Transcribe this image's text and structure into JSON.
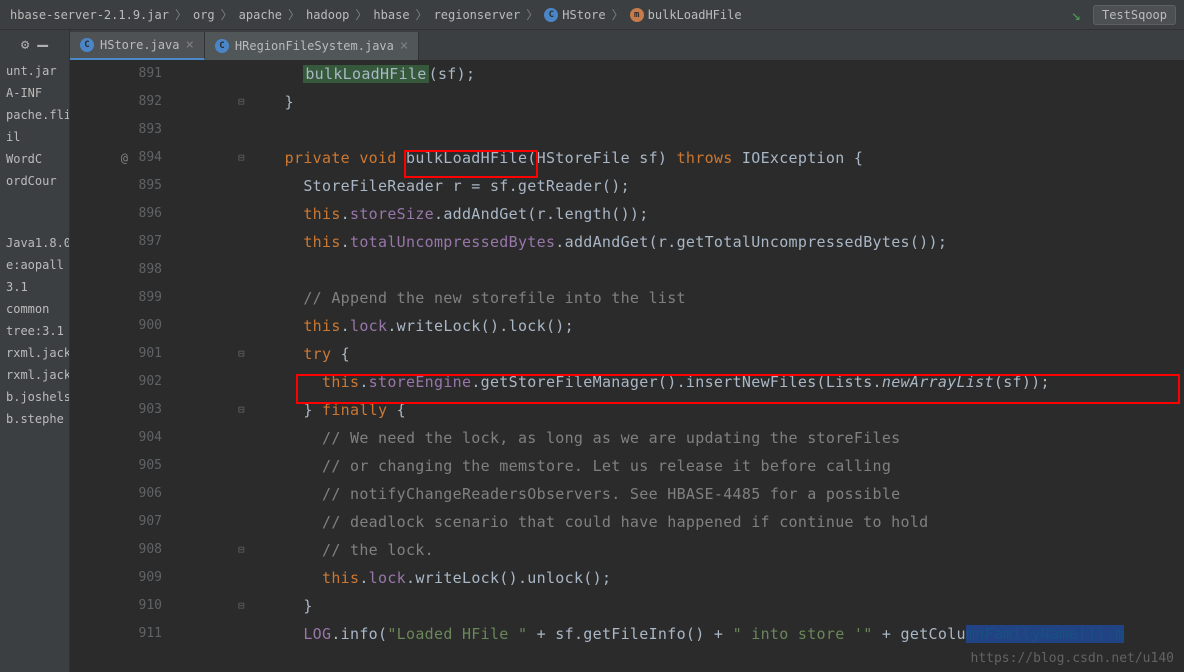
{
  "breadcrumb": {
    "jar": "hbase-server-2.1.9.jar",
    "parts": [
      "org",
      "apache",
      "hadoop",
      "hbase",
      "regionserver"
    ],
    "class": "HStore",
    "method": "bulkLoadHFile"
  },
  "config_name": "TestSqoop",
  "tabs": [
    {
      "label": "HStore.java",
      "active": true
    },
    {
      "label": "HRegionFileSystem.java",
      "active": false
    }
  ],
  "sidebar": {
    "items": [
      "unt.jar",
      "A-INF",
      "pache.fli",
      "il",
      "WordC",
      "ordCour",
      "",
      "",
      "",
      "",
      "",
      "Java1.8.0",
      "e:aopall",
      "3.1",
      "common",
      "tree:3.1",
      "rxml.jack",
      "rxml.jack",
      "b.joshels",
      "b.stephe"
    ]
  },
  "lines": [
    {
      "num": "891",
      "indent": 2,
      "tokens": [
        {
          "t": "method-highlight",
          "v": "bulkLoadHFile"
        },
        {
          "t": "",
          "v": "(sf);"
        }
      ]
    },
    {
      "num": "892",
      "indent": 1,
      "fold": true,
      "tokens": [
        {
          "t": "",
          "v": "}"
        }
      ]
    },
    {
      "num": "893",
      "indent": 0,
      "tokens": []
    },
    {
      "num": "894",
      "anno": "@",
      "fold": true,
      "indent": 1,
      "tokens": [
        {
          "t": "kw",
          "v": "private void "
        },
        {
          "t": "",
          "v": "bulkLoadHFile(HStoreFile sf) "
        },
        {
          "t": "kw",
          "v": "throws "
        },
        {
          "t": "",
          "v": "IOException {"
        }
      ]
    },
    {
      "num": "895",
      "indent": 2,
      "tokens": [
        {
          "t": "",
          "v": "StoreFileReader r = sf.getReader();"
        }
      ]
    },
    {
      "num": "896",
      "indent": 2,
      "tokens": [
        {
          "t": "kw",
          "v": "this"
        },
        {
          "t": "",
          "v": "."
        },
        {
          "t": "field",
          "v": "storeSize"
        },
        {
          "t": "",
          "v": ".addAndGet(r.length());"
        }
      ]
    },
    {
      "num": "897",
      "indent": 2,
      "tokens": [
        {
          "t": "kw",
          "v": "this"
        },
        {
          "t": "",
          "v": "."
        },
        {
          "t": "field",
          "v": "totalUncompressedBytes"
        },
        {
          "t": "",
          "v": ".addAndGet(r.getTotalUncompressedBytes());"
        }
      ]
    },
    {
      "num": "898",
      "indent": 0,
      "tokens": []
    },
    {
      "num": "899",
      "indent": 2,
      "tokens": [
        {
          "t": "comment",
          "v": "// Append the new storefile into the list"
        }
      ]
    },
    {
      "num": "900",
      "indent": 2,
      "tokens": [
        {
          "t": "kw",
          "v": "this"
        },
        {
          "t": "",
          "v": "."
        },
        {
          "t": "field",
          "v": "lock"
        },
        {
          "t": "",
          "v": ".writeLock().lock();"
        }
      ]
    },
    {
      "num": "901",
      "indent": 2,
      "fold": true,
      "tokens": [
        {
          "t": "kw",
          "v": "try "
        },
        {
          "t": "",
          "v": "{"
        }
      ]
    },
    {
      "num": "902",
      "indent": 3,
      "tokens": [
        {
          "t": "kw",
          "v": "this"
        },
        {
          "t": "",
          "v": "."
        },
        {
          "t": "field",
          "v": "storeEngine"
        },
        {
          "t": "",
          "v": ".getStoreFileManager().insertNewFiles(Lists."
        },
        {
          "t": "italic-static",
          "v": "newArrayList"
        },
        {
          "t": "",
          "v": "(sf));"
        }
      ]
    },
    {
      "num": "903",
      "indent": 2,
      "fold": true,
      "tokens": [
        {
          "t": "",
          "v": "} "
        },
        {
          "t": "kw",
          "v": "finally "
        },
        {
          "t": "",
          "v": "{"
        }
      ]
    },
    {
      "num": "904",
      "indent": 3,
      "tokens": [
        {
          "t": "comment",
          "v": "// We need the lock, as long as we are updating the storeFiles"
        }
      ]
    },
    {
      "num": "905",
      "indent": 3,
      "tokens": [
        {
          "t": "comment",
          "v": "// or changing the memstore. Let us release it before calling"
        }
      ]
    },
    {
      "num": "906",
      "indent": 3,
      "tokens": [
        {
          "t": "comment",
          "v": "// notifyChangeReadersObservers. See HBASE-4485 for a possible"
        }
      ]
    },
    {
      "num": "907",
      "indent": 3,
      "tokens": [
        {
          "t": "comment",
          "v": "// deadlock scenario that could have happened if continue to hold"
        }
      ]
    },
    {
      "num": "908",
      "indent": 3,
      "fold": true,
      "tokens": [
        {
          "t": "comment",
          "v": "// the lock."
        }
      ]
    },
    {
      "num": "909",
      "indent": 3,
      "tokens": [
        {
          "t": "kw",
          "v": "this"
        },
        {
          "t": "",
          "v": "."
        },
        {
          "t": "field",
          "v": "lock"
        },
        {
          "t": "",
          "v": ".writeLock().unlock();"
        }
      ]
    },
    {
      "num": "910",
      "indent": 2,
      "fold": true,
      "tokens": [
        {
          "t": "",
          "v": "}"
        }
      ]
    },
    {
      "num": "911",
      "indent": 2,
      "tokens": [
        {
          "t": "field",
          "v": "LOG"
        },
        {
          "t": "",
          "v": ".info("
        },
        {
          "t": "str",
          "v": "\"Loaded HFile \""
        },
        {
          "t": "",
          "v": " + sf.getFileInfo() + "
        },
        {
          "t": "str",
          "v": "\" into store '\""
        },
        {
          "t": "",
          "v": " + getColu"
        },
        {
          "t": "selected-blue",
          "v": "mnFamilyName()).m"
        }
      ]
    }
  ],
  "watermark": "https://blog.csdn.net/u140"
}
